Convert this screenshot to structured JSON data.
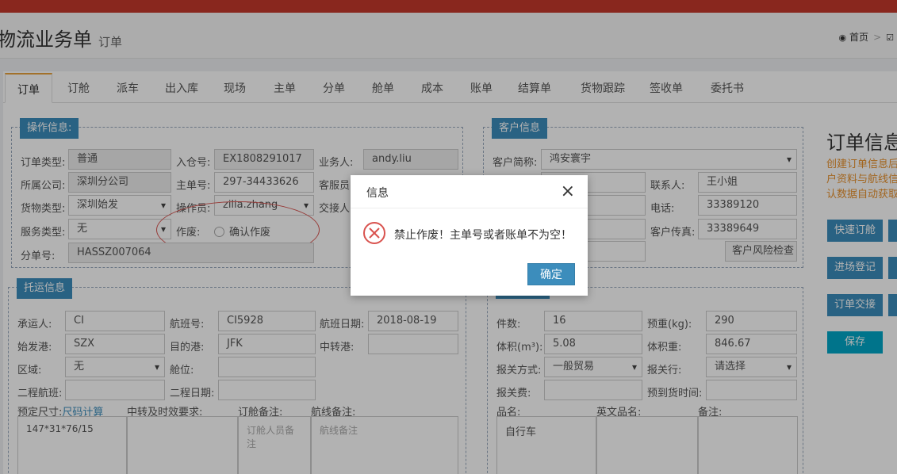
{
  "header": {
    "title": "物流业务单",
    "subtitle": "订单",
    "breadcrumb": [
      "首页",
      ""
    ]
  },
  "tabs": [
    {
      "label": "订单",
      "active": true
    },
    {
      "label": "订舱"
    },
    {
      "label": "派车"
    },
    {
      "label": "出入库"
    },
    {
      "label": "现场"
    },
    {
      "label": "主单"
    },
    {
      "label": "分单"
    },
    {
      "label": "舱单"
    },
    {
      "label": "成本"
    },
    {
      "label": "账单"
    },
    {
      "label": "结算单"
    },
    {
      "label": "货物跟踪"
    },
    {
      "label": "签收单"
    },
    {
      "label": "委托书"
    }
  ],
  "operation": {
    "legend": "操作信息:",
    "order_type_label": "订单类型:",
    "order_type": "普通",
    "warehouse_no_label": "入仓号:",
    "warehouse_no": "EX1808291017",
    "salesman_label": "业务人:",
    "salesman": "andy.liu",
    "company_label": "所属公司:",
    "company": "深圳分公司",
    "master_no_label": "主单号:",
    "master_no": "297-34433626",
    "cs_label": "客服员",
    "cargo_type_label": "货物类型:",
    "cargo_type": "深圳始发",
    "operator_label": "操作员:",
    "operator": "zilia.zhang",
    "handover_label": "交接人",
    "service_type_label": "服务类型:",
    "service_type": "无",
    "void_label": "作废:",
    "void_option": "确认作废",
    "house_no_label": "分单号:",
    "house_no": "HASSZ007064"
  },
  "customer": {
    "legend": "客户信息",
    "short_name_label": "客户简称:",
    "short_name": "鸿安寰宇",
    "contact_label": "联系人:",
    "contact": "王小姐",
    "phone_label": "电话:",
    "phone": "33389120",
    "fax_label": "客户传真:",
    "fax": "33389649",
    "risk_button": "客户风险检查"
  },
  "shipping": {
    "legend": "托运信息",
    "carrier_label": "承运人:",
    "carrier": "CI",
    "flight_no_label": "航班号:",
    "flight_no": "CI5928",
    "flight_date_label": "航班日期:",
    "flight_date": "2018-08-19",
    "origin_label": "始发港:",
    "origin": "SZX",
    "dest_label": "目的港:",
    "dest": "JFK",
    "transit_label": "中转港:",
    "transit": "",
    "region_label": "区域:",
    "region": "无",
    "cabin_label": "舱位:",
    "cabin": "",
    "second_flight_label": "二程航班:",
    "second_flight": "",
    "second_date_label": "二程日期:",
    "second_date": "",
    "size_label": "预定尺寸:",
    "size_link": "尺码计算",
    "transit_req_label": "中转及时效要求:",
    "booking_note_label": "订舱备注:",
    "route_note_label": "航线备注:",
    "size_value": "147*31*76/15",
    "booking_note_ph": "订舱人员备注",
    "route_note_ph": "航线备注"
  },
  "cargo": {
    "pieces_label": "件数:",
    "pieces": "16",
    "pre_weight_label": "预重(kg):",
    "pre_weight": "290",
    "volume_label": "体积(m³):",
    "volume": "5.08",
    "vol_weight_label": "体积重:",
    "vol_weight": "846.67",
    "declare_label": "报关方式:",
    "declare": "一般贸易",
    "customs_label": "报关行:",
    "customs": "请选择",
    "declare_fee_label": "报关费:",
    "declare_fee": "",
    "eta_label": "预到货时间:",
    "eta": "",
    "name_label": "品名:",
    "name": "自行车",
    "en_name_label": "英文品名:",
    "en_name": "",
    "remark_label": "备注:",
    "remark": ""
  },
  "right_panel": {
    "title": "订单信息",
    "lines": [
      "创建订单信息后",
      "户资料与航线信",
      "认数据自动获取"
    ],
    "buttons": [
      "快速订舱",
      "进场登记",
      "订单交接"
    ],
    "save": "保存"
  },
  "modal": {
    "title": "信息",
    "message": "禁止作废！主单号或者账单不为空！",
    "ok": "确定",
    "close": "×"
  },
  "colors": {
    "accent": "#3c8dbc",
    "top_bar": "#c4392b",
    "error": "#d9534f",
    "tab_highlight": "#e8a33d"
  }
}
